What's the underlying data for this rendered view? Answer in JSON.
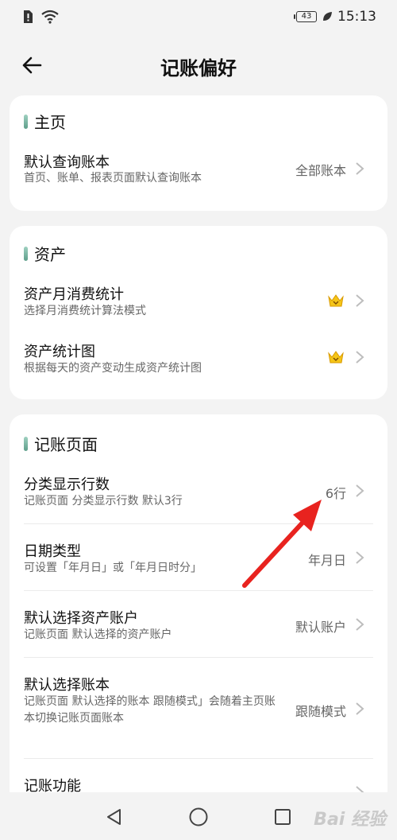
{
  "status": {
    "battery": "43",
    "time": "15:13"
  },
  "header": {
    "title": "记账偏好"
  },
  "sections": {
    "home": {
      "title": "主页",
      "items": [
        {
          "title": "默认查询账本",
          "subtitle": "首页、账单、报表页面默认查询账本",
          "value": "全部账本"
        }
      ]
    },
    "assets": {
      "title": "资产",
      "items": [
        {
          "title": "资产月消费统计",
          "subtitle": "选择月消费统计算法模式",
          "badge": "crown-icon"
        },
        {
          "title": "资产统计图",
          "subtitle": "根据每天的资产变动生成资产统计图",
          "badge": "crown-icon"
        }
      ]
    },
    "record": {
      "title": "记账页面",
      "items": [
        {
          "title": "分类显示行数",
          "subtitle": "记账页面 分类显示行数 默认3行",
          "value": "6行"
        },
        {
          "title": "日期类型",
          "subtitle": "可设置「年月日」或「年月日时分」",
          "value": "年月日"
        },
        {
          "title": "默认选择资产账户",
          "subtitle": "记账页面 默认选择的资产账户",
          "value": "默认账户"
        },
        {
          "title": "默认选择账本",
          "subtitle": "记账页面 默认选择的账本 跟随模式」会随着主页账本切换记账页面账本",
          "value": "跟随模式"
        },
        {
          "title": "记账功能"
        }
      ]
    }
  },
  "watermark": "Bai 经验",
  "colors": {
    "accent_bar": "#5e9e8a",
    "arrow": "#e8231f",
    "crown": "#f2b705"
  }
}
